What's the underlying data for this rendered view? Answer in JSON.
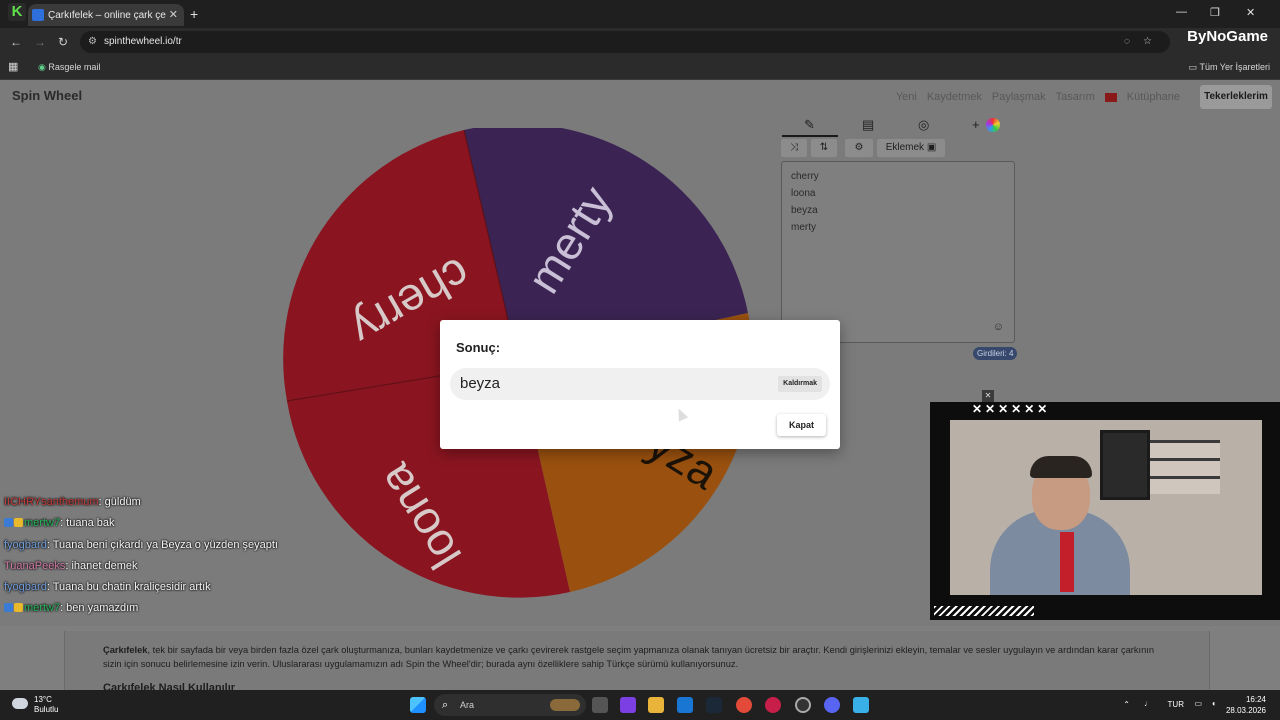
{
  "browser": {
    "tab_title": "Çarkıfelek – online çark çevirme",
    "url": "spinthewheel.io/tr",
    "bookmark_mail": "Rasgele mail",
    "bookmark_all": "Tüm Yer İşaretleri",
    "overlay_brand": "ByNoGame"
  },
  "site": {
    "logo": "Spin Wheel",
    "menu": [
      "Yeni",
      "Kaydetmek",
      "Paylaşmak",
      "Tasarım",
      "Kütüphane"
    ],
    "wheels_button": "Tekerleklerim",
    "add_image_button": "Eklemek",
    "entries": [
      "cherry",
      "loona",
      "beyza",
      "merty"
    ],
    "entry_count": "Girdileri: 4"
  },
  "wheel": {
    "segments": [
      {
        "label": "merty",
        "color": "#3b2453"
      },
      {
        "label": "beyza",
        "color": "#9a510f"
      },
      {
        "label": "loona",
        "color": "#8a1520"
      },
      {
        "label": "cherry",
        "color": "#8a1520"
      }
    ]
  },
  "modal": {
    "title": "Sonuç:",
    "result": "beyza",
    "remove_label": "Kaldırmak",
    "close_label": "Kapat"
  },
  "chat": [
    {
      "user": "IICHRYsanthemum",
      "user_color": "#c23a3a",
      "text": ": güldüm"
    },
    {
      "user": "mertw7",
      "user_color": "#24b35a",
      "text": ": tuana bak"
    },
    {
      "user": "fyogbard",
      "user_color": "#6f9bd8",
      "text": ": Tuana beni çıkardı ya Beyza o yüzden şeyaptı"
    },
    {
      "user": "TuanaPeeks",
      "user_color": "#d07aa5",
      "text": ": ihanet demek"
    },
    {
      "user": "fyogbard",
      "user_color": "#6f9bd8",
      "text": ": Tuana bu chatin kraliçesidir artık"
    },
    {
      "user": "mertw7",
      "user_color": "#24b35a",
      "text": ": ben yamazdım"
    }
  ],
  "footer": {
    "brand": "Çarkıfelek",
    "text": ", tek bir sayfada bir veya birden fazla özel çark oluşturmanıza, bunları kaydetmenize ve çarkı çevirerek rastgele seçim yapmanıza olanak tanıyan ücretsiz bir araçtır. Kendi girişlerinizi ekleyin, temalar ve sesler uygulayın ve ardından karar çarkının sizin için sonucu belirlemesine izin verin. Uluslararası uygulamamızın adı Spin the Wheel'dir; burada aynı özelliklere sahip Türkçe sürümü kullanıyorsunuz.",
    "howto": "Çarkıfelek Nasıl Kullanılır"
  },
  "taskbar": {
    "temperature": "13°C",
    "weather": "Bulutlu",
    "search": "Ara",
    "lang": "TUR",
    "time": "16:24",
    "date": "28.03.2026"
  }
}
